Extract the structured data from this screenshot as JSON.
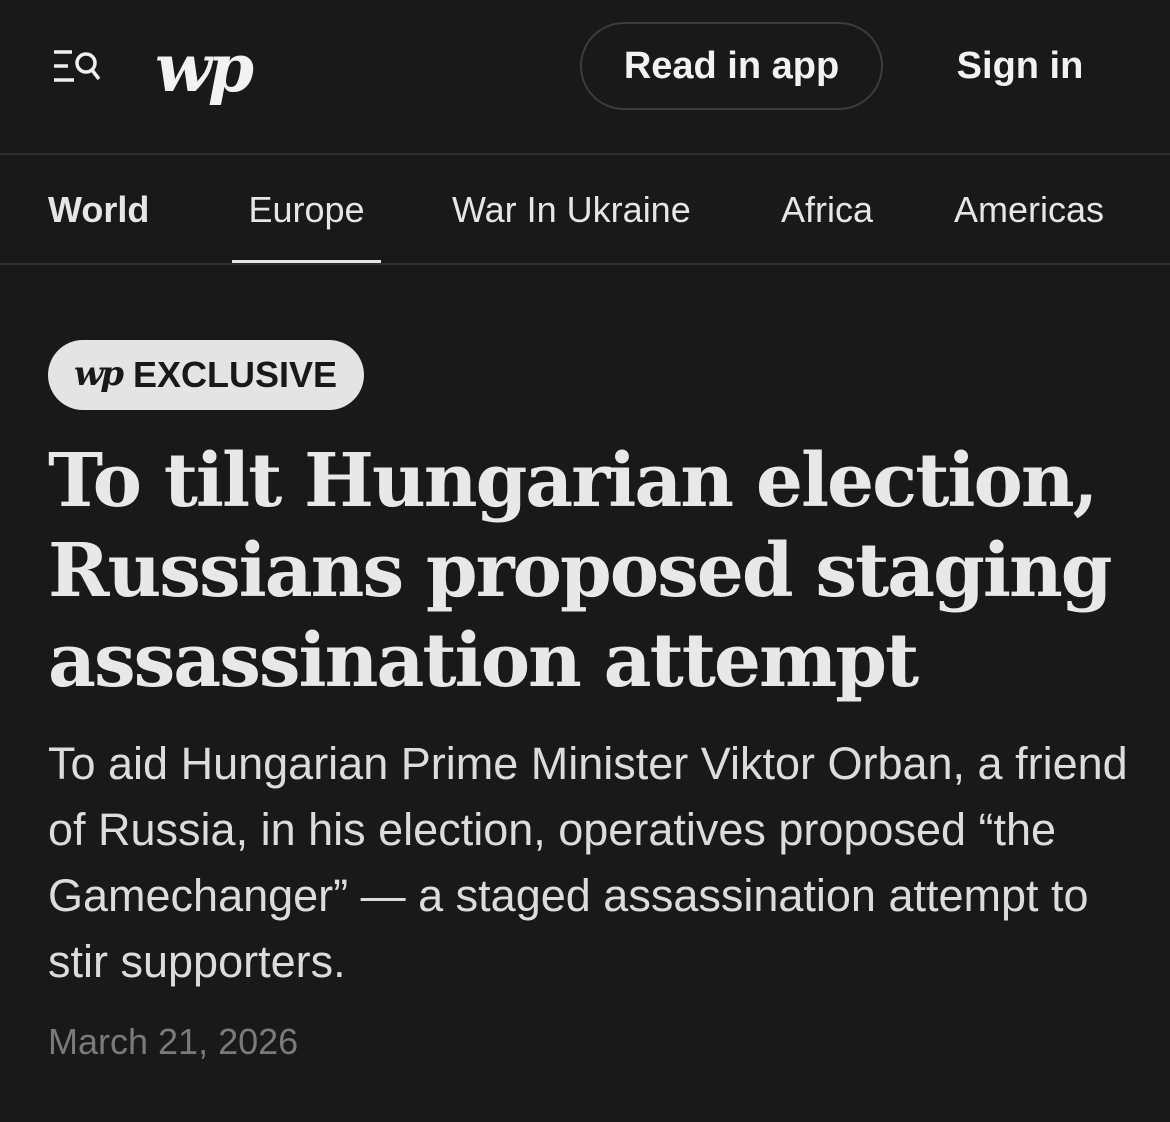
{
  "header": {
    "logo_text": "wp",
    "read_in_app_label": "Read in app",
    "sign_in_label": "Sign in"
  },
  "subnav": {
    "items": [
      {
        "label": "World",
        "active": false,
        "section_title": true
      },
      {
        "label": "Europe",
        "active": true
      },
      {
        "label": "War In Ukraine",
        "active": false
      },
      {
        "label": "Africa",
        "active": false
      },
      {
        "label": "Americas",
        "active": false
      }
    ]
  },
  "article": {
    "badge_logo": "wp",
    "badge_label": "EXCLUSIVE",
    "headline": "To tilt Hungarian election, Russians proposed staging assassination attempt",
    "dek": "To aid Hungarian Prime Minister Viktor Orban, a friend of Russia, in his election, operatives proposed “the Gamechanger” — a staged assassination attempt to stir supporters.",
    "date": "March 21, 2026"
  },
  "colors": {
    "background": "#191919",
    "text": "#e8e8e8",
    "muted": "#7a7a7a",
    "badge_bg": "#e4e4e4"
  },
  "icons": {
    "menu": "menu-search-icon"
  }
}
